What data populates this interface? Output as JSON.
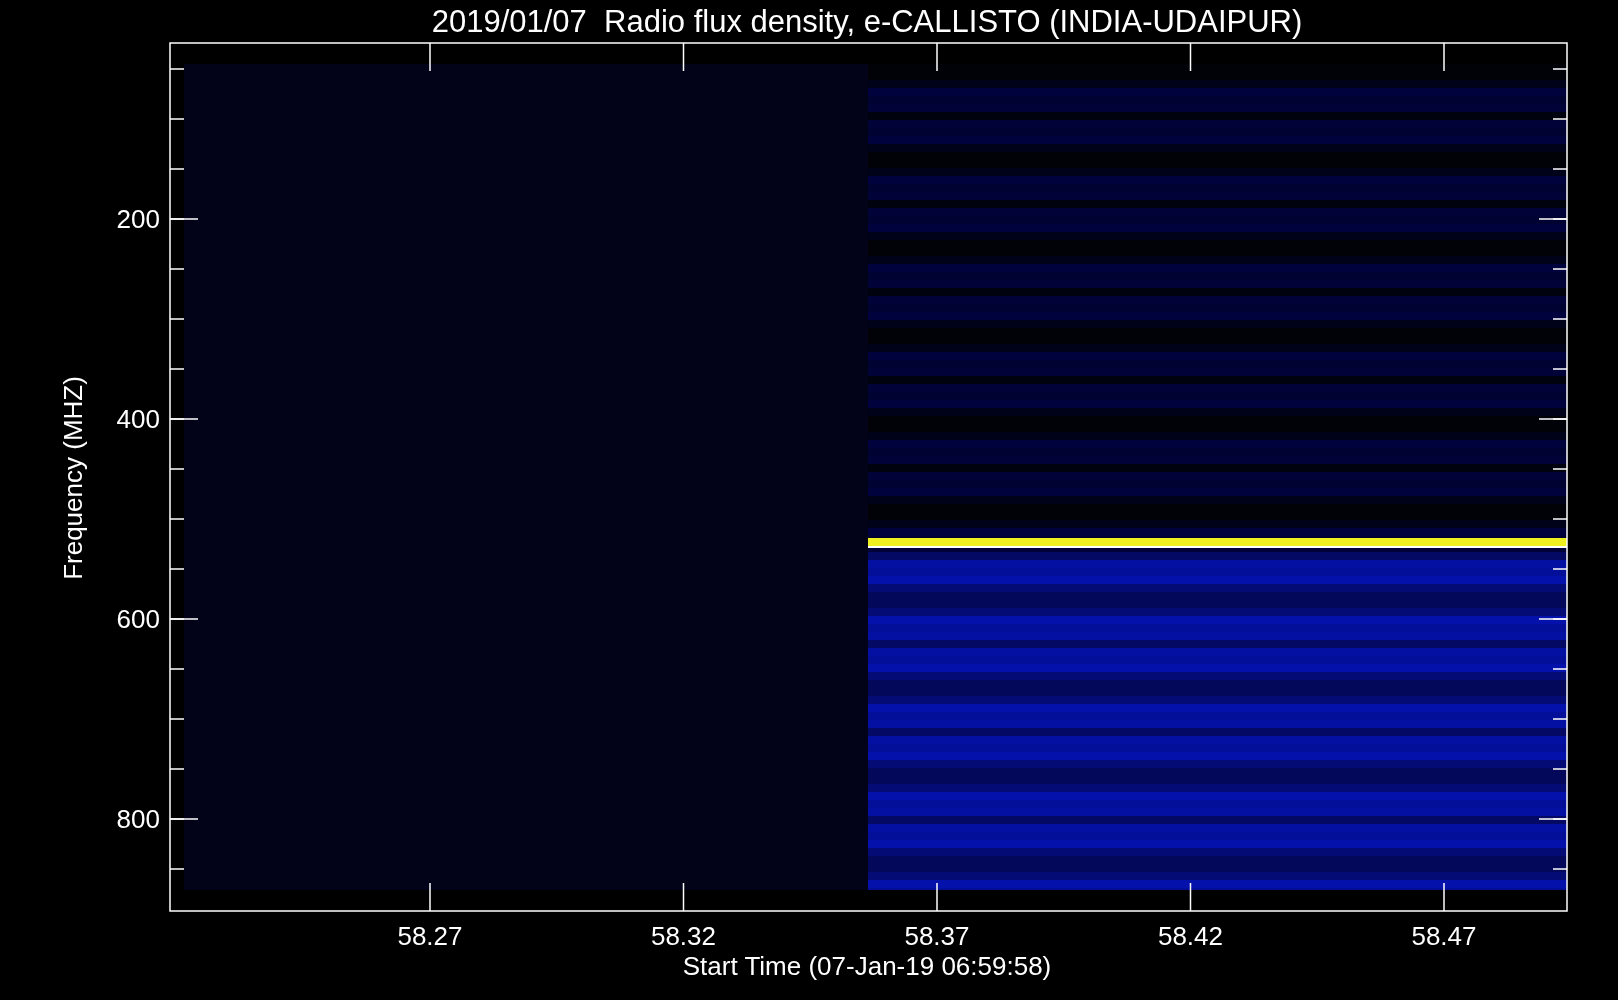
{
  "chart": {
    "title": "2019/01/07  Radio flux density, e-CALLISTO (INDIA-UDAIPUR)",
    "xlabel": "Start Time (07-Jan-19 06:59:58)",
    "ylabel": "Frequency (MHZ)",
    "xtick_labels": [
      "58.27",
      "58.32",
      "58.37",
      "58.42",
      "58.47"
    ],
    "ytick_labels": [
      "200",
      "400",
      "600",
      "800"
    ]
  }
}
